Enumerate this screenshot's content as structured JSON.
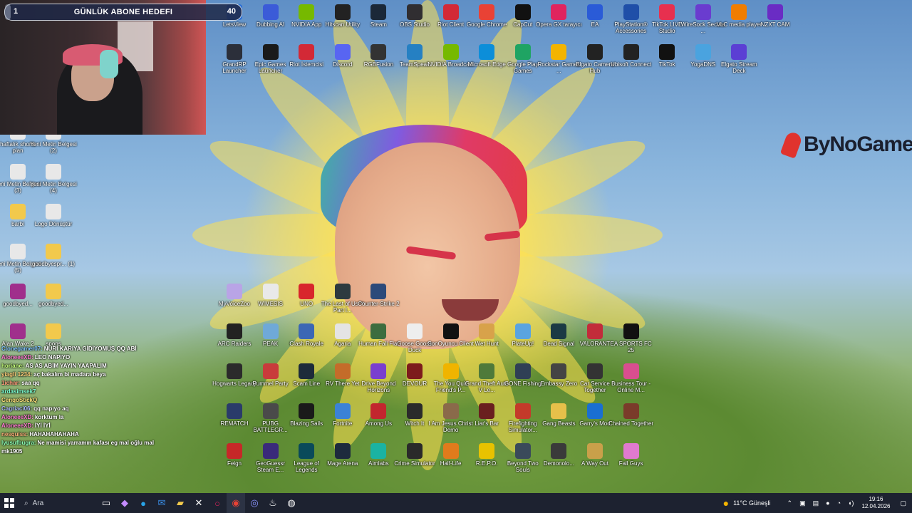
{
  "goal_bar": {
    "current": "1",
    "title": "GÜNLÜK ABONE HEDEFI",
    "target": "40",
    "progress": 0.025
  },
  "brand": {
    "text": "ByNoGame"
  },
  "desktop_icons_top": [
    {
      "label": "LetsView",
      "icon": "letsview-icon",
      "color": "#2a6fd6"
    },
    {
      "label": "Dubbing AI",
      "icon": "dubbing-icon",
      "color": "#3b5bd8"
    },
    {
      "label": "NVIDIA App",
      "icon": "nvidia-icon",
      "color": "#76b900"
    },
    {
      "label": "Hitscan Utility",
      "icon": "hitscan-icon",
      "color": "#222"
    },
    {
      "label": "Steam",
      "icon": "steam-icon",
      "color": "#1b2838"
    },
    {
      "label": "OBS Studio",
      "icon": "obs-icon",
      "color": "#302e31"
    },
    {
      "label": "Riot Client",
      "icon": "riot-icon",
      "color": "#d32936"
    },
    {
      "label": "Google Chrome",
      "icon": "chrome-icon",
      "color": "#e94235"
    },
    {
      "label": "CapCut",
      "icon": "capcut-icon",
      "color": "#111"
    },
    {
      "label": "Opera GX tarayıcı",
      "icon": "opera-icon",
      "color": "#e0245e"
    },
    {
      "label": "EA",
      "icon": "ea-icon",
      "color": "#2a5bd7"
    },
    {
      "label": "PlayStation® Accessories",
      "icon": "playstation-icon",
      "color": "#1f4fa8"
    },
    {
      "label": "TikTok LIVE Studio",
      "icon": "tiktok-live-icon",
      "color": "#e7304f"
    },
    {
      "label": "WireSock Secure ...",
      "icon": "wiresock-icon",
      "color": "#6a3ccf"
    },
    {
      "label": "VLC media player",
      "icon": "vlc-icon",
      "color": "#f07d00"
    },
    {
      "label": "NZXT CAM",
      "icon": "nzxt-icon",
      "color": "#6a2cc4"
    }
  ],
  "desktop_icons_row2": [
    {
      "label": "GrandRP Launcher",
      "icon": "grandrp-icon",
      "color": "#2b2f3a"
    },
    {
      "label": "Epic Games Launcher",
      "icon": "epic-icon",
      "color": "#1a1a1a"
    },
    {
      "label": "Riot İstemcisi",
      "icon": "riot-icon",
      "color": "#d32936"
    },
    {
      "label": "Discord",
      "icon": "discord-icon",
      "color": "#5865f2"
    },
    {
      "label": "RGBFusion",
      "icon": "rgbfusion-icon",
      "color": "#333"
    },
    {
      "label": "TeamSpeak",
      "icon": "teamspeak-icon",
      "color": "#2580c3"
    },
    {
      "label": "NVIDIA Broadcast",
      "icon": "nvidia-icon",
      "color": "#76b900"
    },
    {
      "label": "Microsoft Edge",
      "icon": "edge-icon",
      "color": "#0c8ed9"
    },
    {
      "label": "Google Play Games",
      "icon": "playgames-icon",
      "color": "#1fa463"
    },
    {
      "label": "Rockstar Games ...",
      "icon": "rockstar-icon",
      "color": "#f4b400"
    },
    {
      "label": "Elgato Camera Hub",
      "icon": "elgato-icon",
      "color": "#222"
    },
    {
      "label": "Ubisoft Connect",
      "icon": "ubisoft-icon",
      "color": "#222"
    },
    {
      "label": "TikTok",
      "icon": "tiktok-icon",
      "color": "#111"
    },
    {
      "label": "YogaDNS",
      "icon": "yogadns-icon",
      "color": "#4aa3df"
    },
    {
      "label": "Elgato Stream Deck",
      "icon": "streamdeck-icon",
      "color": "#5b3fd4"
    }
  ],
  "left_icons": [
    {
      "label": "haftalık shorts plan",
      "icon": "text-file-icon",
      "color": "#e8e8e8"
    },
    {
      "label": "Yeni Metin Belgesi (2)",
      "icon": "text-file-icon",
      "color": "#e8e8e8"
    },
    {
      "label": "Yeni Metin Belgesi (3)",
      "icon": "text-file-icon",
      "color": "#e8e8e8"
    },
    {
      "label": "Yeni Metin Belgesi (4)",
      "icon": "text-file-icon",
      "color": "#e8e8e8"
    },
    {
      "label": "barbi",
      "icon": "folder-icon",
      "color": "#f2c94c"
    },
    {
      "label": "Logo Dönüştür",
      "icon": "file-icon",
      "color": "#e8e8e8"
    },
    {
      "label": "Yeni Metin Belgesi (5)",
      "icon": "text-file-icon",
      "color": "#e8e8e8"
    },
    {
      "label": "goodbyespr... (1)",
      "icon": "folder-icon",
      "color": "#f2c94c"
    },
    {
      "label": "goodbyed...",
      "icon": "archive-icon",
      "color": "#a02f8c"
    },
    {
      "label": "goodbyed...",
      "icon": "folder-icon",
      "color": "#f2c94c"
    },
    {
      "label": "Alan Wake 2",
      "icon": "archive-icon",
      "color": "#a02f8c"
    },
    {
      "label": "spons",
      "icon": "folder-icon",
      "color": "#f2c94c"
    }
  ],
  "game_icons": [
    {
      "label": "MyVoiceZoo",
      "icon": "myvoicezoo-icon",
      "color": "#b9a4e6"
    },
    {
      "label": "WIMESIS",
      "icon": "wimesis-icon",
      "color": "#e9e9e9"
    },
    {
      "label": "UNO",
      "icon": "uno-icon",
      "color": "#d8262c"
    },
    {
      "label": "The Last of Us™ Part I...",
      "icon": "tlou-icon",
      "color": "#2d3a3f"
    },
    {
      "label": "Counter-Strike 2",
      "icon": "cs2-icon",
      "color": "#2c4a7a"
    },
    {
      "label": "ARC Raiders",
      "icon": "arc-icon",
      "color": "#222"
    },
    {
      "label": "PEAK",
      "icon": "peak-icon",
      "color": "#6fa9d8"
    },
    {
      "label": "Clash Royale",
      "icon": "clash-icon",
      "color": "#3b67b5"
    },
    {
      "label": "Agaria",
      "icon": "agaria-icon",
      "color": "#e4e4e4"
    },
    {
      "label": "Human Fall Flat",
      "icon": "hff-icon",
      "color": "#3c6d3f"
    },
    {
      "label": "Goose Goose Duck",
      "icon": "ggd-icon",
      "color": "#eee"
    },
    {
      "label": "SonOyuncu Client",
      "icon": "sonoyuncu-icon",
      "color": "#111"
    },
    {
      "label": "Wet Hunt",
      "icon": "wethunt-icon",
      "color": "#d8a24a"
    },
    {
      "label": "PlateUp!",
      "icon": "plateup-icon",
      "color": "#5aa4e0"
    },
    {
      "label": "Dead Signal",
      "icon": "deadsignal-icon",
      "color": "#1b3a44"
    },
    {
      "label": "VALORANT",
      "icon": "valorant-icon",
      "color": "#c22c3a"
    },
    {
      "label": "EA SPORTS FC 25",
      "icon": "fc25-icon",
      "color": "#111"
    },
    {
      "label": "Hogwarts Legacy",
      "icon": "hogwarts-icon",
      "color": "#2b2b2b"
    },
    {
      "label": "Pummel Party",
      "icon": "pummel-icon",
      "color": "#c93b3b"
    },
    {
      "label": "Scam Line",
      "icon": "scamline-icon",
      "color": "#1d2b3a"
    },
    {
      "label": "RV There Yet",
      "icon": "rv-icon",
      "color": "#c46c2a"
    },
    {
      "label": "Drive Beyond Horizons",
      "icon": "drive-icon",
      "color": "#7a3fd0"
    },
    {
      "label": "DEVOUR",
      "icon": "devour-icon",
      "color": "#7d1c1c"
    },
    {
      "label": "The You Quiz Friend's P...",
      "icon": "youquiz-icon",
      "color": "#f0b400"
    },
    {
      "label": "Grand Theft Auto V Le...",
      "icon": "gta-icon",
      "color": "#4f7a3a"
    },
    {
      "label": "GONE Fishing",
      "icon": "gonefishing-icon",
      "color": "#2f3f55"
    },
    {
      "label": "Embassy Zero",
      "icon": "embassy-icon",
      "color": "#444"
    },
    {
      "label": "Car Service Together",
      "icon": "carservice-icon",
      "color": "#333"
    },
    {
      "label": "Business Tour - Online M...",
      "icon": "businesstour-icon",
      "color": "#d94e8f"
    },
    {
      "label": "REMATCH",
      "icon": "rematch-icon",
      "color": "#2a3b6a"
    },
    {
      "label": "PUBG BATTLEGR...",
      "icon": "pubg-icon",
      "color": "#4a4a4a"
    },
    {
      "label": "Blazing Sails",
      "icon": "blazing-icon",
      "color": "#1a1a1a"
    },
    {
      "label": "Fortnite",
      "icon": "fortnite-icon",
      "color": "#3b82d6"
    },
    {
      "label": "Among Us",
      "icon": "amongus-icon",
      "color": "#c2262e"
    },
    {
      "label": "Witch It",
      "icon": "witchit-icon",
      "color": "#2b2b2b"
    },
    {
      "label": "I Am Jesus Christ Demo",
      "icon": "jesus-icon",
      "color": "#8a6a4a"
    },
    {
      "label": "Liar's Bar",
      "icon": "liarsbar-icon",
      "color": "#6a1f1f"
    },
    {
      "label": "Firefighting Simulator...",
      "icon": "firefighting-icon",
      "color": "#c43a2a"
    },
    {
      "label": "Gang Beasts",
      "icon": "gangbeasts-icon",
      "color": "#e6c04a"
    },
    {
      "label": "Garry's Mod",
      "icon": "gmod-icon",
      "color": "#1a6fd1"
    },
    {
      "label": "Chained Together",
      "icon": "chained-icon",
      "color": "#7a3b2a"
    },
    {
      "label": "Feign",
      "icon": "feign-icon",
      "color": "#c62828"
    },
    {
      "label": "GeoGuessr Steam E...",
      "icon": "geoguessr-icon",
      "color": "#3a2a7a"
    },
    {
      "label": "League of Legends",
      "icon": "lol-icon",
      "color": "#0a4a5a"
    },
    {
      "label": "Mage Arena",
      "icon": "magearena-icon",
      "color": "#1d2a3d"
    },
    {
      "label": "Aimlabs",
      "icon": "aimlabs-icon",
      "color": "#1bb3a2"
    },
    {
      "label": "Crime Simulator",
      "icon": "crimesim-icon",
      "color": "#2a2a2a"
    },
    {
      "label": "Half-Life",
      "icon": "halflife-icon",
      "color": "#e07b1c"
    },
    {
      "label": "R.E.P.O.",
      "icon": "repo-icon",
      "color": "#e8c200"
    },
    {
      "label": "Beyond Two Souls",
      "icon": "beyond-icon",
      "color": "#3a4a5a"
    },
    {
      "label": "Demonolo...",
      "icon": "demonologist-icon",
      "color": "#3a3a3a"
    },
    {
      "label": "A Way Out",
      "icon": "awayout-icon",
      "color": "#c9a04a"
    },
    {
      "label": "Fall Guys",
      "icon": "fallguys-icon",
      "color": "#e07ad0"
    }
  ],
  "chat": [
    {
      "user": "Clonegamer07",
      "text": "NURİ KARIYA GİDİYOMUŞ QQ ABİ",
      "color": "#7fc1ff"
    },
    {
      "user": "AloneeeXD",
      "text": "LEO NAPIYO",
      "color": "#ff7ad1"
    },
    {
      "user": "horiane",
      "text": "AS AS ABİM YAYIN YAAPALIM",
      "color": "#c4ff7a"
    },
    {
      "user": "yiagli 1234",
      "text": "aç bakalım bi madara beya",
      "color": "#ffd07a"
    },
    {
      "user": "1ichar",
      "text": "saa qq",
      "color": "#ff9a7a"
    },
    {
      "user": "ardasimsek7",
      "text": "",
      "color": "#7affd2"
    },
    {
      "user": "CenqoStickQ",
      "text": "",
      "color": "#ffe27a"
    },
    {
      "user": "Cagriaci06",
      "text": "qq napıyo aq",
      "color": "#a9b8ff"
    },
    {
      "user": "AloneeeXD",
      "text": "korktum la",
      "color": "#ff7ad1"
    },
    {
      "user": "AloneeeXD",
      "text": "İYİ İYİ",
      "color": "#ff7ad1"
    },
    {
      "user": "nesquiss",
      "text": "HAHAHAHAHAHA",
      "color": "#ffb37a"
    },
    {
      "user": "lyusufbugra",
      "text": "Ne mamisi yarramın kafası eg mal oğlu mal",
      "color": "#8affb5"
    },
    {
      "user": "mk1905",
      "text": "",
      "color": "#ffffff"
    }
  ],
  "taskbar": {
    "search_label": "Ara",
    "weather": "11°C Güneşli",
    "time": "19:16",
    "date": "12.04.2026"
  }
}
